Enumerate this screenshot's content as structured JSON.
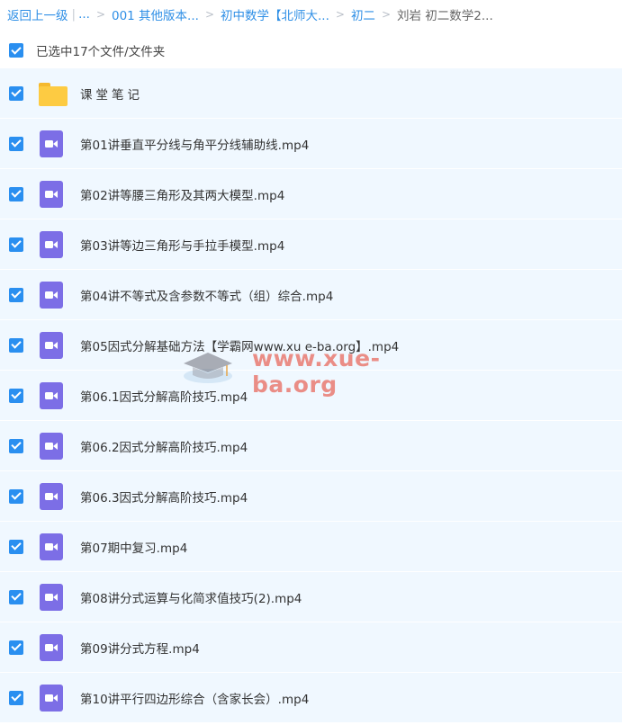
{
  "breadcrumb": {
    "back": "返回上一级",
    "bar": "|",
    "ellipsis": "...",
    "chevron": ">",
    "crumb1": "001 其他版本...",
    "crumb2": "初中数学【北师大...",
    "crumb3": "初二",
    "current": "刘岩 初二数学2..."
  },
  "selection": {
    "label": "已选中17个文件/文件夹",
    "checked": true
  },
  "files": [
    {
      "type": "folder",
      "name": "课堂笔记"
    },
    {
      "type": "video",
      "name": "第01讲垂直平分线与角平分线辅助线.mp4"
    },
    {
      "type": "video",
      "name": "第02讲等腰三角形及其两大模型.mp4"
    },
    {
      "type": "video",
      "name": "第03讲等边三角形与手拉手模型.mp4"
    },
    {
      "type": "video",
      "name": "第04讲不等式及含参数不等式（组）综合.mp4"
    },
    {
      "type": "video",
      "name": "第05因式分解基础方法【学霸网www.xu e-ba.org】.mp4"
    },
    {
      "type": "video",
      "name": "第06.1因式分解高阶技巧.mp4"
    },
    {
      "type": "video",
      "name": "第06.2因式分解高阶技巧.mp4"
    },
    {
      "type": "video",
      "name": "第06.3因式分解高阶技巧.mp4"
    },
    {
      "type": "video",
      "name": "第07期中复习.mp4"
    },
    {
      "type": "video",
      "name": "第08讲分式运算与化简求值技巧(2).mp4"
    },
    {
      "type": "video",
      "name": "第09讲分式方程.mp4"
    },
    {
      "type": "video",
      "name": "第10讲平行四边形综合（含家长会）.mp4"
    }
  ],
  "watermark": {
    "text": "www.xue-ba.org"
  },
  "colors": {
    "accent": "#2a8ff0",
    "row_bg": "#f0f8ff",
    "video_icon": "#7c6ee6",
    "folder": "#fdcb42",
    "watermark": "#e86e64"
  }
}
